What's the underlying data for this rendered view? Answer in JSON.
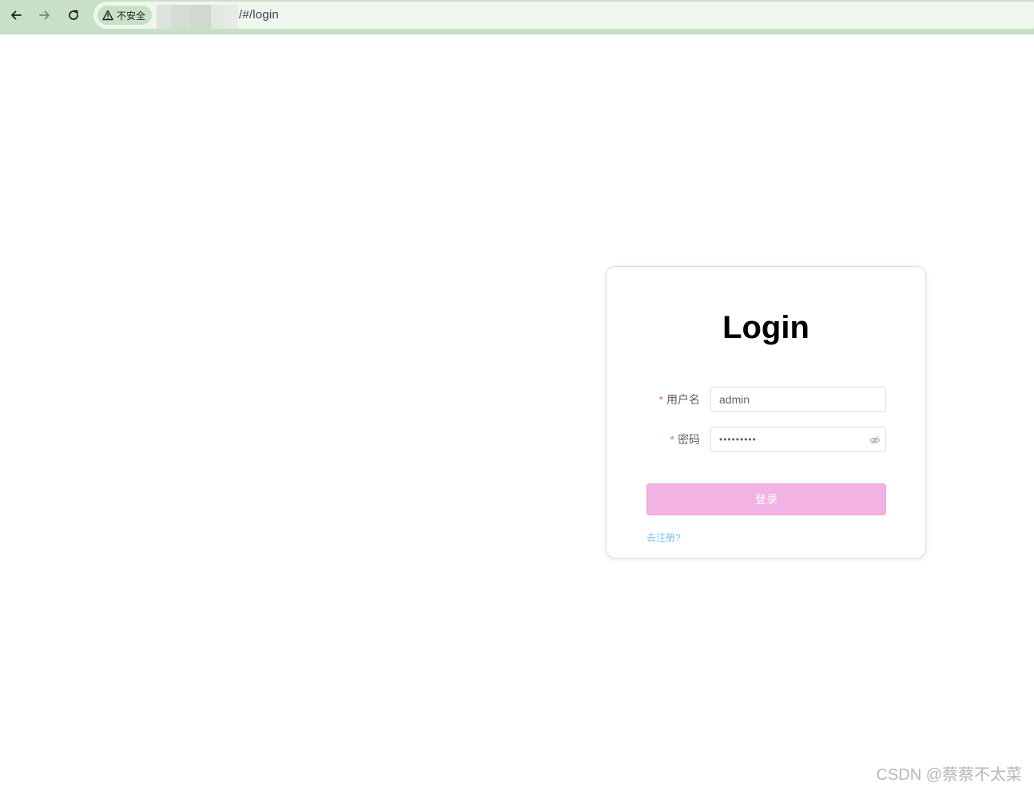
{
  "browser": {
    "security_label": "不安全",
    "url_path": "/#/login",
    "toolbar_color": "#c8e1c6",
    "omnibox_color": "#eff6ee"
  },
  "login": {
    "title": "Login",
    "username_label": "用户名",
    "username_value": "admin",
    "password_label": "密码",
    "password_value": "•••••••••",
    "required_mark": "*",
    "submit_label": "登录",
    "register_link": "去注册?",
    "button_color": "#f2b2e3",
    "link_color": "#7ec0ee",
    "required_color": "#f56c6c"
  },
  "watermark": {
    "text": "CSDN @蔡蔡不太菜"
  },
  "icons": {
    "back": "arrow-left-icon",
    "forward": "arrow-right-icon",
    "reload": "reload-icon",
    "warning": "warning-icon",
    "password_toggle": "eye-hidden-icon"
  }
}
